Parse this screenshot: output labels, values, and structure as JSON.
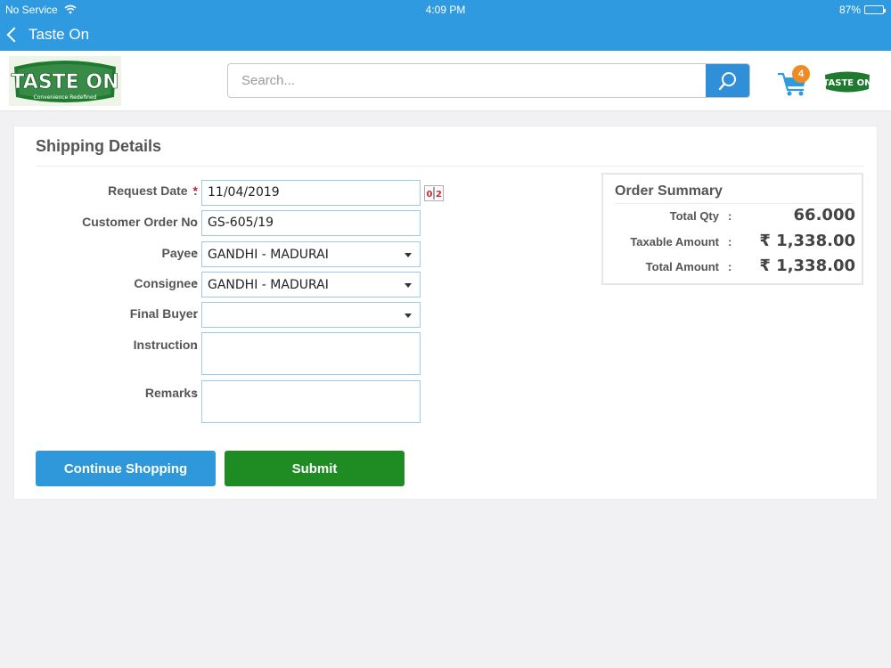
{
  "status_bar": {
    "carrier": "No Service",
    "time": "4:09 PM",
    "battery": "87%",
    "battery_level": 0.87
  },
  "nav": {
    "back_title": "Taste On"
  },
  "header": {
    "logo_text": "TASTE ON",
    "logo_tagline": "Convenience Redefined",
    "search_placeholder": "Search...",
    "cart_count": "4",
    "small_logo_text": "TASTE ON"
  },
  "shipping": {
    "title": "Shipping Details",
    "fields": {
      "request_date": {
        "label": "Request Date",
        "required": "*",
        "value": "11/04/2019",
        "calendar_glyph": "0|2"
      },
      "customer_order_no": {
        "label": "Customer Order No",
        "value": "GS-605/19"
      },
      "payee": {
        "label": "Payee",
        "value": "GANDHI - MADURAI"
      },
      "consignee": {
        "label": "Consignee",
        "value": "GANDHI - MADURAI"
      },
      "final_buyer": {
        "label": "Final Buyer",
        "value": ""
      },
      "instruction": {
        "label": "Instruction",
        "value": ""
      },
      "remarks": {
        "label": "Remarks",
        "value": ""
      }
    },
    "colon": ":",
    "buttons": {
      "continue": "Continue Shopping",
      "submit": "Submit"
    }
  },
  "order_summary": {
    "title": "Order Summary",
    "rows": [
      {
        "label": "Total Qty",
        "value": "66.000"
      },
      {
        "label": "Taxable Amount",
        "value": "₹ 1,338.00"
      },
      {
        "label": "Total Amount",
        "value": "₹ 1,338.00"
      }
    ]
  },
  "colors": {
    "nav_blue": "#2f9ae0",
    "continue_blue": "#2f98db",
    "submit_green": "#1e8c23",
    "badge_orange": "#f08a24",
    "logo_green": "#1d7a2e"
  }
}
